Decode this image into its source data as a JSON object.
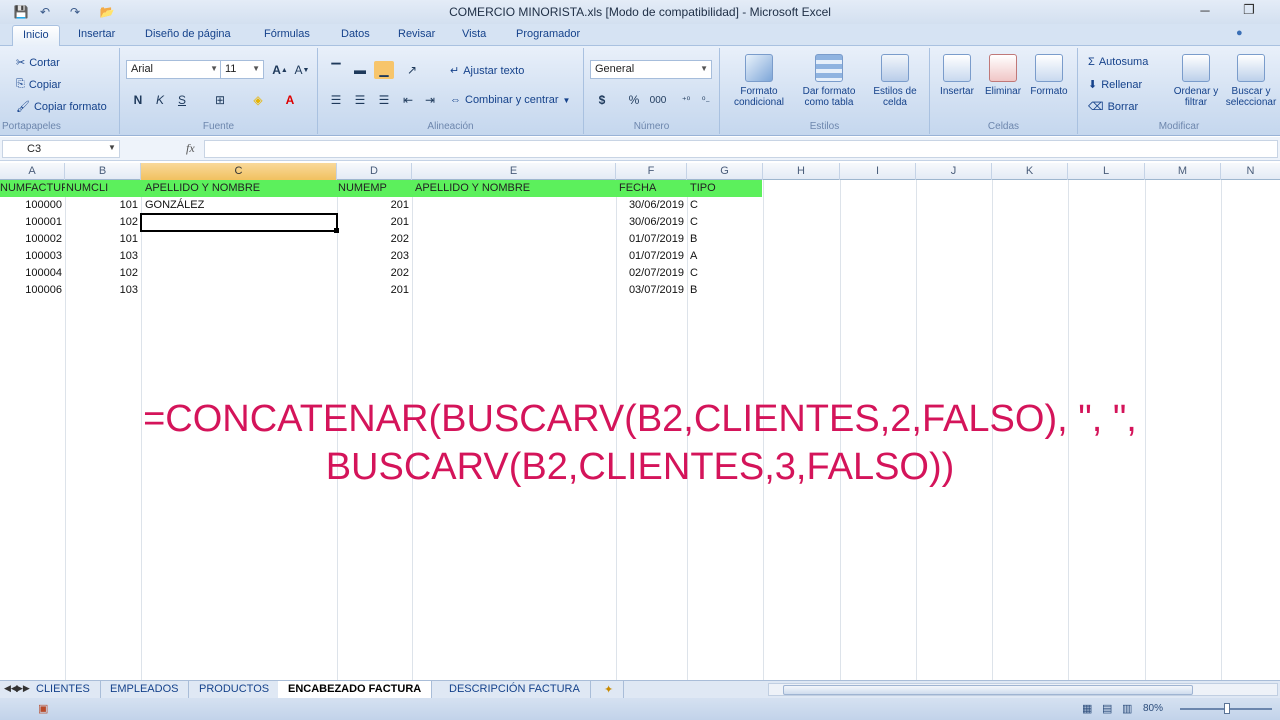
{
  "window": {
    "title": "COMERCIO MINORISTA.xls  [Modo de compatibilidad] - Microsoft Excel",
    "minimize": "─",
    "restore": "❐"
  },
  "ribbon_tabs": [
    "Inicio",
    "Insertar",
    "Diseño de página",
    "Fórmulas",
    "Datos",
    "Revisar",
    "Vista",
    "Programador"
  ],
  "clipboard": {
    "cut": "Cortar",
    "copy": "Copiar",
    "format_painter": "Copiar formato",
    "label": "Portapapeles"
  },
  "font": {
    "family": "Arial",
    "size": "11",
    "label": "Fuente",
    "bold": "N",
    "italic": "K",
    "underline": "S"
  },
  "alignment": {
    "wrap": "Ajustar texto",
    "merge": "Combinar y centrar",
    "label": "Alineación"
  },
  "number": {
    "format": "General",
    "label": "Número",
    "currency": "$",
    "percent": "%",
    "thousands": "000"
  },
  "styles": {
    "conditional": "Formato condicional",
    "table": "Dar formato como tabla",
    "cell_styles": "Estilos de celda",
    "label": "Estilos"
  },
  "cells": {
    "insert": "Insertar",
    "delete": "Eliminar",
    "format": "Formato",
    "label": "Celdas"
  },
  "editing": {
    "autosum": "Autosuma",
    "fill": "Rellenar",
    "clear": "Borrar",
    "sort": "Ordenar y filtrar",
    "find": "Buscar y seleccionar",
    "label": "Modificar"
  },
  "formula_bar": {
    "name_box": "C3",
    "fx": "fx"
  },
  "columns": [
    "A",
    "B",
    "C",
    "D",
    "E",
    "F",
    "G",
    "H",
    "I",
    "J",
    "K",
    "L",
    "M",
    "N"
  ],
  "selected_column": "C",
  "sheet": {
    "headers": [
      "NUMFACTURA",
      "NUMCLI",
      "APELLIDO  Y NOMBRE",
      "NUMEMP",
      "APELLIDO Y NOMBRE",
      "FECHA",
      "TIPO"
    ],
    "rows": [
      [
        "100000",
        "101",
        "GONZÁLEZ",
        "201",
        "",
        "30/06/2019",
        "C"
      ],
      [
        "100001",
        "102",
        "",
        "201",
        "",
        "30/06/2019",
        "C"
      ],
      [
        "100002",
        "101",
        "",
        "202",
        "",
        "01/07/2019",
        "B"
      ],
      [
        "100003",
        "103",
        "",
        "203",
        "",
        "01/07/2019",
        "A"
      ],
      [
        "100004",
        "102",
        "",
        "202",
        "",
        "02/07/2019",
        "C"
      ],
      [
        "100006",
        "103",
        "",
        "201",
        "",
        "03/07/2019",
        "B"
      ]
    ]
  },
  "overlay_formula": {
    "line1": "=CONCATENAR(BUSCARV(B2,CLIENTES,2,FALSO), \", \",",
    "line2": "BUSCARV(B2,CLIENTES,3,FALSO))"
  },
  "sheet_tabs": [
    "CLIENTES",
    "EMPLEADOS",
    "PRODUCTOS",
    "ENCABEZADO FACTURA",
    "DESCRIPCIÓN FACTURA"
  ],
  "active_sheet": "ENCABEZADO FACTURA",
  "status": {
    "zoom": "80%"
  },
  "colors": {
    "header_row": "#5cf05c",
    "overlay_text": "#d4145a",
    "selected_column_header": "#f1c15f"
  }
}
